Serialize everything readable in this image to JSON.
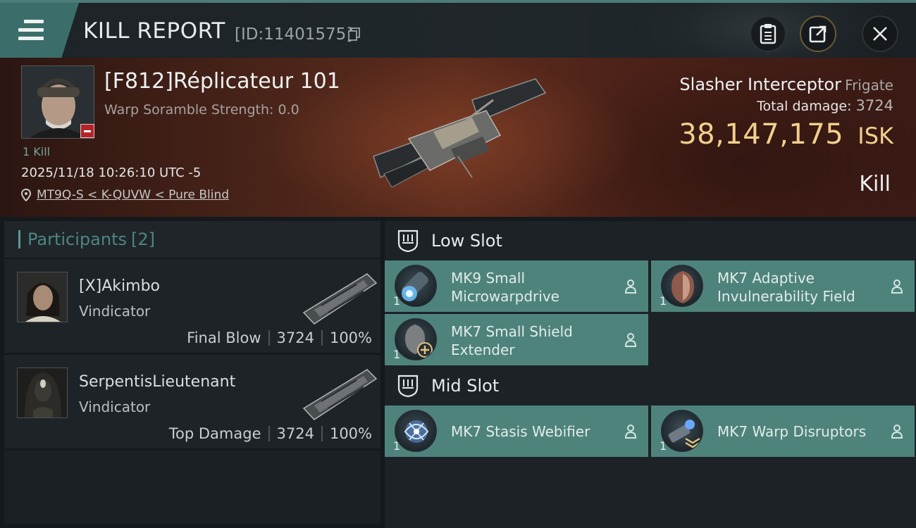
{
  "header": {
    "title": "KILL REPORT",
    "report_id": "[ID:11401575]"
  },
  "victim": {
    "name": "[F812]Réplicateur 101",
    "scramble": "Warp Soramble Strength: 0.0",
    "kills": "1 Kill",
    "datetime": "2025/11/18 10:26:10 UTC -5",
    "location": "MT9Q-S < K-QUVW < Pure Blind"
  },
  "ship": {
    "name": "Slasher Interceptor",
    "class": "Frigate",
    "total_damage_label": "Total damage:",
    "total_damage": "3724",
    "isk_value": "38,147,175",
    "isk_unit": "ISK",
    "result": "Kill"
  },
  "participants": {
    "label": "Participants",
    "count": "[2]",
    "items": [
      {
        "name": "[X]Akimbo",
        "ship": "Vindicator",
        "role": "Final Blow",
        "damage": "3724",
        "percent": "100%"
      },
      {
        "name": "SerpentisLieutenant",
        "ship": "Vindicator",
        "role": "Top Damage",
        "damage": "3724",
        "percent": "100%"
      }
    ]
  },
  "slots": {
    "low": {
      "label": "Low Slot",
      "modules": [
        {
          "name": "MK9 Small Microwarpdrive",
          "qty": "1"
        },
        {
          "name": "MK7 Adaptive Invulnerability Field",
          "qty": "1"
        },
        {
          "name": "MK7 Small Shield Extender",
          "qty": "1"
        }
      ]
    },
    "mid": {
      "label": "Mid Slot",
      "modules": [
        {
          "name": "MK7 Stasis Webifier",
          "qty": "1"
        },
        {
          "name": "MK7 Warp Disruptors",
          "qty": "1"
        }
      ]
    }
  },
  "icons": {
    "menu": "menu-icon",
    "copy": "copy-icon",
    "clipboard": "clipboard-icon",
    "share": "share-icon",
    "close": "close-icon",
    "location": "location-pin-icon",
    "slot": "slot-shield-icon",
    "user": "user-icon"
  },
  "colors": {
    "accent": "#4e837b",
    "isk": "#f1d08e",
    "header_accent": "#3b6e6a"
  }
}
